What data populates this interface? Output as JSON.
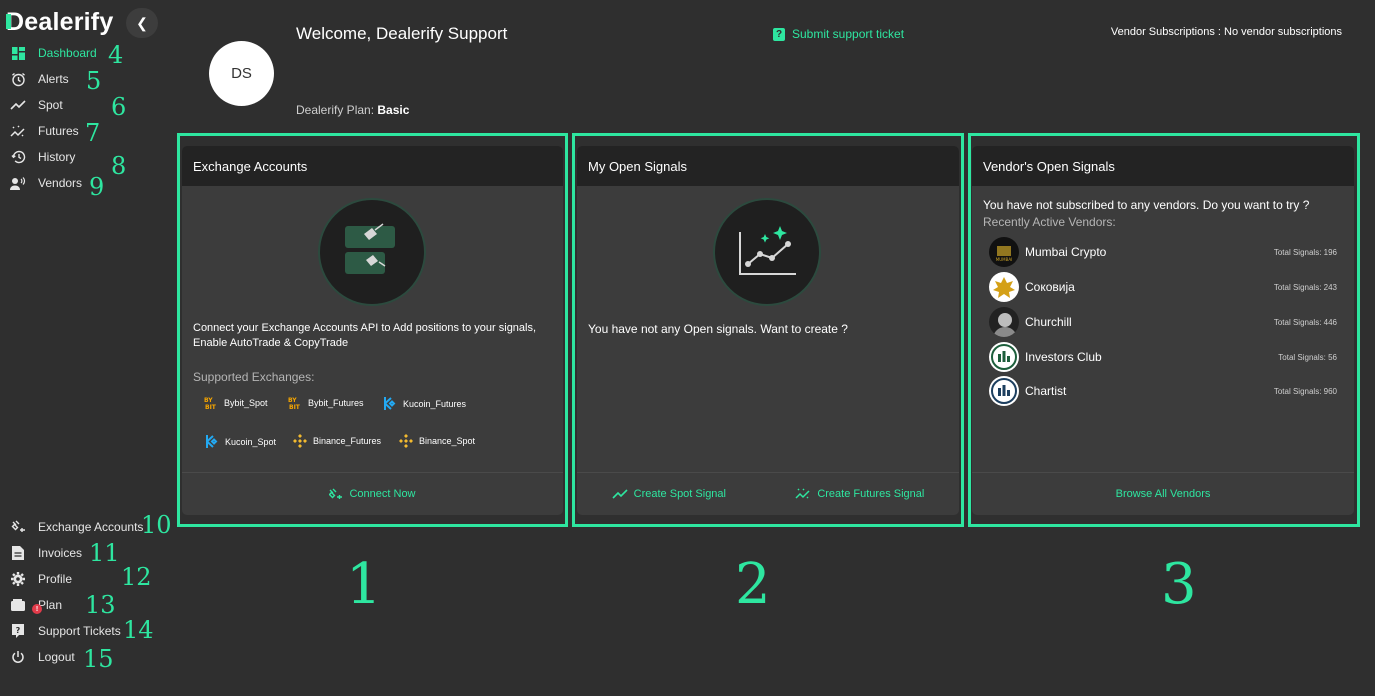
{
  "brand": {
    "name": "ealerify",
    "first_letter": "D"
  },
  "sidebar": {
    "top_items": [
      {
        "label": "Dashboard",
        "num": "4"
      },
      {
        "label": "Alerts",
        "num": "5"
      },
      {
        "label": "Spot",
        "num": "6"
      },
      {
        "label": "Futures",
        "num": "7"
      },
      {
        "label": "History",
        "num": "8"
      },
      {
        "label": "Vendors",
        "num": "9"
      }
    ],
    "bottom_items": [
      {
        "label": "Exchange Accounts",
        "num": "10"
      },
      {
        "label": "Invoices",
        "num": "11"
      },
      {
        "label": "Profile",
        "num": "12"
      },
      {
        "label": "Plan",
        "num": "13",
        "badge": "!"
      },
      {
        "label": "Support Tickets",
        "num": "14"
      },
      {
        "label": "Logout",
        "num": "15"
      }
    ]
  },
  "header": {
    "avatar_initials": "DS",
    "welcome": "Welcome, Dealerify Support",
    "plan_label": "Dealerify Plan: ",
    "plan_value": "Basic",
    "support_link": "Submit support ticket",
    "vendor_subscriptions": "Vendor Subscriptions : No vendor subscriptions"
  },
  "cards": {
    "exchange": {
      "title": "Exchange Accounts",
      "description": "Connect your Exchange Accounts API to Add positions to your signals, Enable AutoTrade & CopyTrade",
      "supported_label": "Supported Exchanges:",
      "exchanges": [
        "Bybit_Spot",
        "Bybit_Futures",
        "Kucoin_Futures",
        "Kucoin_Spot",
        "Binance_Futures",
        "Binance_Spot"
      ],
      "footer": "Connect Now",
      "marker": "1"
    },
    "signals": {
      "title": "My Open Signals",
      "empty_text": "You have not any Open signals. Want to create ?",
      "spot_btn": "Create Spot Signal",
      "futures_btn": "Create Futures Signal",
      "marker": "2"
    },
    "vendors": {
      "title": "Vendor's Open Signals",
      "intro": "You have not subscribed to any vendors. Do you want to try ?",
      "recent_label": "Recently Active Vendors:",
      "list": [
        {
          "name": "Mumbai Crypto",
          "signals": "Total Signals: 196"
        },
        {
          "name": "Соковија",
          "signals": "Total Signals: 243"
        },
        {
          "name": "Churchill",
          "signals": "Total Signals: 446"
        },
        {
          "name": "Investors Club",
          "signals": "Total Signals: 56"
        },
        {
          "name": "Chartist",
          "signals": "Total Signals: 960"
        }
      ],
      "footer": "Browse All Vendors",
      "marker": "3"
    }
  },
  "colors": {
    "accent": "#2ee6a0",
    "background": "#2f2f2f",
    "card": "#3c3c3c",
    "card_header": "#232323"
  }
}
